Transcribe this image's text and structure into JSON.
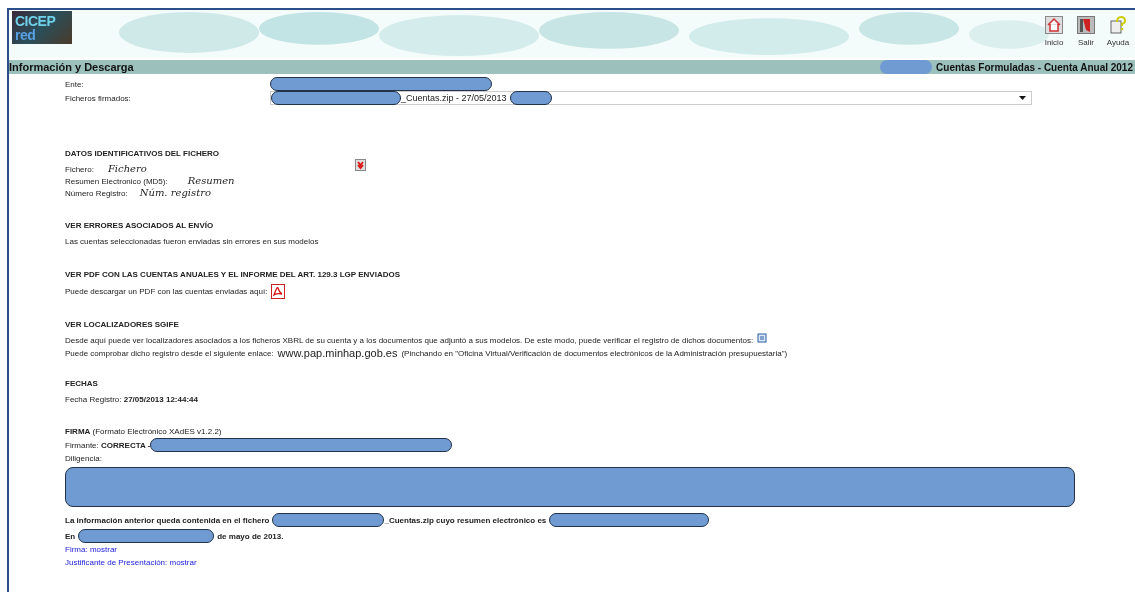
{
  "header": {
    "logo": {
      "line_1": "CICEP",
      "line_2": "red"
    },
    "toolbar": [
      {
        "label": "Inicio",
        "kind": "home"
      },
      {
        "label": "Salir",
        "kind": "exit"
      },
      {
        "label": "Ayuda",
        "kind": "help"
      }
    ]
  },
  "title_bar": {
    "title": "Información y Descarga",
    "context": "Cuentas Formuladas - Cuenta Anual 2012"
  },
  "form": {
    "entity_label": "Ente:",
    "files_label": "Ficheros firmados:",
    "files_value": "_Cuentas.zip - 27/05/2013"
  },
  "sections": [
    {
      "kind": "fields",
      "heading": "DATOS IDENTIFICATIVOS DEL FICHERO",
      "rows": [
        {
          "label": "Fichero:",
          "value": "Fichero"
        },
        {
          "label": "Resumen Electronico (MD5):",
          "value": "Resumen"
        },
        {
          "label": "Número Registro:",
          "value": "Núm. registro"
        }
      ]
    },
    {
      "kind": "text",
      "heading": "VER ERRORES ASOCIADOS AL ENVÍO",
      "text": "Las cuentas seleccionadas fueron enviadas sin errores en sus modelos"
    },
    {
      "kind": "pdf",
      "heading": "VER PDF CON LAS CUENTAS ANUALES Y EL INFORME DEL ART. 129.3 LGP ENVIADOS",
      "text": "Puede descargar un PDF con las cuentas enviadas aquí:"
    },
    {
      "kind": "locators",
      "heading": "VER LOCALIZADORES SGIFE",
      "text": "Desde aquí puede ver localizadores asociados a los ficheros XBRL de su cuenta y a los documentos que adjuntó a sus modelos. De este modo, puede verificar el registro de dichos documentos:",
      "prefix": "Puede comprobar dicho registro desde el siguiente enlace:",
      "link": "www.pap.minhap.gob.es",
      "suffix": "(Pinchando en \"Oficina Virtual/Verificación de documentos electrónicos de la Administración presupuestaria\")"
    },
    {
      "kind": "text",
      "heading": "FECHAS",
      "text": "Fecha Registro: **27/05/2013 12:44:44**"
    }
  ],
  "signature": {
    "heading": "**FIRMA** (Formato Electrónico XAdES v1.2.2)",
    "signer": "Firmante: **CORRECTA -**",
    "diligence_label": "Diligencia:"
  },
  "summary": {
    "file_prefix": "La información anterior queda contenida en el fichero",
    "file_suffix": "_Cuentas.zip cuyo resumen electrónico es",
    "place_prefix": "En",
    "date_suffix": "de mayo de 2013."
  },
  "links": [
    {
      "label": "Firma: mostrar"
    },
    {
      "label": "Justificante de Presentación: mostrar"
    }
  ]
}
